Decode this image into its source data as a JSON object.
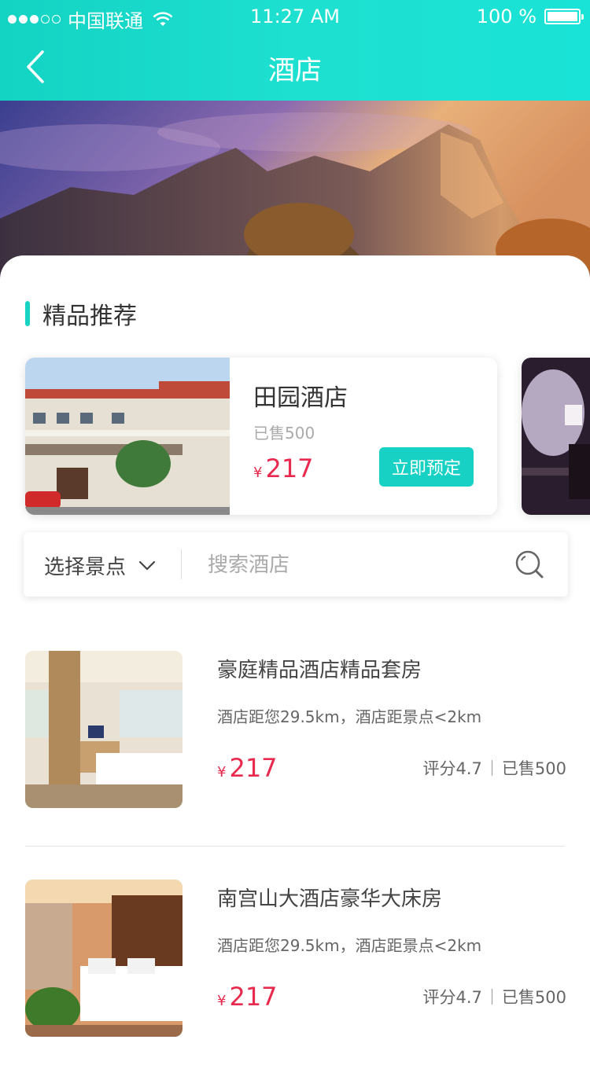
{
  "status_bar": {
    "carrier": "中国联通",
    "time": "11:27 AM",
    "battery": "100 %"
  },
  "nav": {
    "title": "酒店"
  },
  "recommend": {
    "section_title": "精品推荐",
    "card": {
      "name": "田园酒店",
      "sold": "已售500",
      "currency": "¥",
      "price": "217",
      "book_label": "立即预定"
    }
  },
  "search": {
    "scenic_label": "选择景点",
    "placeholder": "搜索酒店"
  },
  "hotels": [
    {
      "name": "豪庭精品酒店精品套房",
      "distance": "酒店距您29.5km，酒店距景点<2km",
      "currency": "¥",
      "price": "217",
      "rating": "评分4.7",
      "sold": "已售500"
    },
    {
      "name": "南宫山大酒店豪华大床房",
      "distance": "酒店距您29.5km，酒店距景点<2km",
      "currency": "¥",
      "price": "217",
      "rating": "评分4.7",
      "sold": "已售500"
    }
  ],
  "colors": {
    "accent": "#17d1c4",
    "price": "#e82a4e"
  }
}
